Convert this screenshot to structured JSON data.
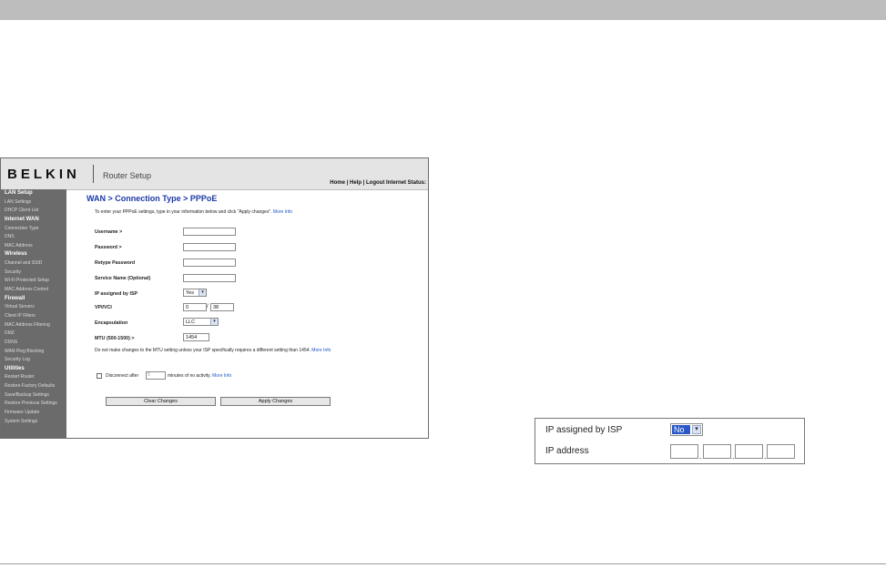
{
  "brand": {
    "logo": "BELKIN",
    "app_title": "Router Setup"
  },
  "header_links": "Home | Help | Logout   Internet Status:",
  "sidebar": {
    "items": [
      {
        "label": "LAN Setup",
        "head": true
      },
      {
        "label": "LAN Settings",
        "head": false
      },
      {
        "label": "DHCP Client List",
        "head": false
      },
      {
        "label": "Internet WAN",
        "head": true
      },
      {
        "label": "Connection Type",
        "head": false
      },
      {
        "label": "DNS",
        "head": false
      },
      {
        "label": "MAC Address",
        "head": false
      },
      {
        "label": "Wireless",
        "head": true
      },
      {
        "label": "Channel and SSID",
        "head": false
      },
      {
        "label": "Security",
        "head": false
      },
      {
        "label": "Wi-Fi Protected Setup",
        "head": false
      },
      {
        "label": "MAC Address Control",
        "head": false
      },
      {
        "label": "Firewall",
        "head": true
      },
      {
        "label": "Virtual Servers",
        "head": false
      },
      {
        "label": "Client IP Filters",
        "head": false
      },
      {
        "label": "MAC Address Filtering",
        "head": false
      },
      {
        "label": "DMZ",
        "head": false
      },
      {
        "label": "DDNS",
        "head": false
      },
      {
        "label": "WAN Ping Blocking",
        "head": false
      },
      {
        "label": "Security Log",
        "head": false
      },
      {
        "label": "Utilities",
        "head": true
      },
      {
        "label": "Restart Router",
        "head": false
      },
      {
        "label": "Restore Factory Defaults",
        "head": false
      },
      {
        "label": "Save/Backup Settings",
        "head": false
      },
      {
        "label": "Restore Previous Settings",
        "head": false
      },
      {
        "label": "Firmware Update",
        "head": false
      },
      {
        "label": "System Settings",
        "head": false
      }
    ]
  },
  "main": {
    "title": "WAN > Connection Type > PPPoE",
    "intro": "To enter your PPPoE settings, type in your information below and click \"Apply changes\".",
    "more_info": "More Info",
    "fields": {
      "username": "Username >",
      "password": "Password >",
      "retype": "Retype Password",
      "service": "Service Name (Optional)",
      "ip_assigned": "IP assigned by ISP",
      "ip_assigned_value": "Yes",
      "vpivci": "VPI/VCI",
      "vpi_value": "0",
      "vci_value": "38",
      "slash": "/",
      "encapsulation": "Encapsulation",
      "encapsulation_value": "LLC",
      "mtu": "MTU (500-1500) >",
      "mtu_value": "1454"
    },
    "mtu_note": "Do not make changes to the MTU setting unless your ISP specifically requires a different setting than 1454.",
    "disconnect_before": "Disconnect after",
    "disconnect_value": "5",
    "disconnect_after": "minutes of no activity.",
    "clear_button": "Clear Changes",
    "apply_button": "Apply Changes"
  },
  "callout": {
    "ip_assigned_label": "IP assigned by ISP",
    "ip_assigned_value": "No",
    "ip_address_label": "IP address",
    "dot": "."
  }
}
